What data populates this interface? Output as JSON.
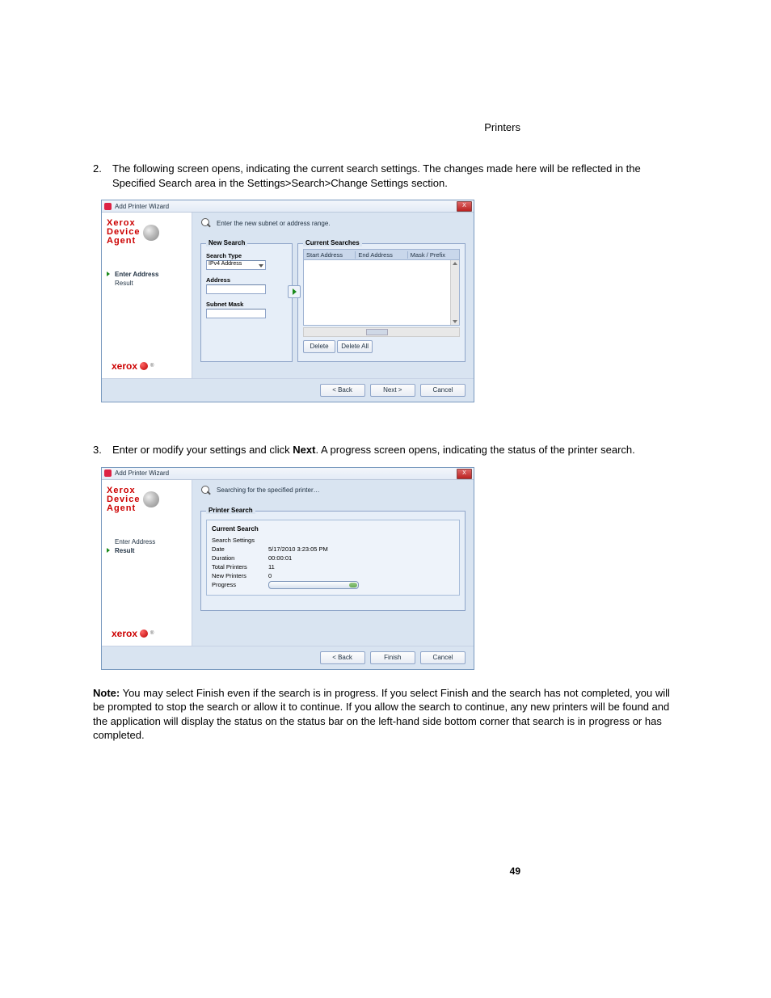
{
  "header": {
    "section": "Printers"
  },
  "step2": {
    "num": "2.",
    "text": "The following screen opens, indicating the current search settings. The changes made here will be reflected in the Specified Search area in the Settings>Search>Change Settings section."
  },
  "step3": {
    "num": "3.",
    "text_pre": "Enter or modify your settings and click ",
    "bold": "Next",
    "text_post": ". A progress screen opens, indicating the status of the printer search."
  },
  "note": {
    "label": "Note:",
    "text": " You may select Finish even if the search is in progress. If you select Finish and the search has not completed, you will be prompted to stop the search or allow it to continue. If you allow the search to continue, any new printers will be found and the application will display the status on the status bar on the left-hand side bottom corner that search is in progress or has completed."
  },
  "page_num": "49",
  "wiz1": {
    "title": "Add Printer Wizard",
    "close": "X",
    "subtitle": "Enter the new subnet or address range.",
    "brand_l1": "Xerox",
    "brand_l2": "Device",
    "brand_l3": "Agent",
    "nav1": "Enter Address",
    "nav2": "Result",
    "logo": "xerox",
    "new_search": "New Search",
    "search_type_lbl": "Search Type",
    "search_type_val": "IPv4 Address",
    "address_lbl": "Address",
    "subnet_lbl": "Subnet Mask",
    "current_searches": "Current Searches",
    "col1": "Start Address",
    "col2": "End Address",
    "col3": "Mask / Prefix",
    "delete": "Delete",
    "delete_all": "Delete All",
    "back": "< Back",
    "next": "Next >",
    "cancel": "Cancel"
  },
  "wiz2": {
    "title": "Add Printer Wizard",
    "close": "X",
    "subtitle": "Searching for the specified printer…",
    "brand_l1": "Xerox",
    "brand_l2": "Device",
    "brand_l3": "Agent",
    "nav1": "Enter Address",
    "nav2": "Result",
    "logo": "xerox",
    "printer_search": "Printer Search",
    "current_search": "Current Search",
    "k_settings": "Search Settings",
    "k_date": "Date",
    "v_date": "5/17/2010 3:23:05 PM",
    "k_duration": "Duration",
    "v_duration": "00:00:01",
    "k_total": "Total Printers",
    "v_total": "11",
    "k_new": "New Printers",
    "v_new": "0",
    "k_progress": "Progress",
    "back": "< Back",
    "finish": "Finish",
    "cancel": "Cancel"
  }
}
